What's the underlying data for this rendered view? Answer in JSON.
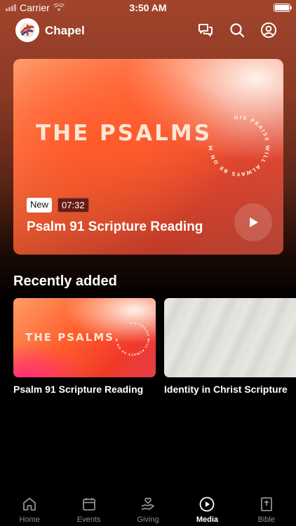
{
  "status_bar": {
    "carrier": "Carrier",
    "time": "3:50 AM"
  },
  "header": {
    "app_title": "Chapel",
    "icons": [
      "chat-icon",
      "search-icon",
      "account-icon"
    ]
  },
  "featured": {
    "artwork_title": "THE PSALMS",
    "artwork_circle_text": "HIS PRAISE WILL ALWAYS BE ON MY LIPS",
    "badge_new": "New",
    "duration": "07:32",
    "title": "Psalm 91 Scripture Reading",
    "icon": "play-icon"
  },
  "recently_added": {
    "heading": "Recently added",
    "items": [
      {
        "title": "Psalm 91 Scripture Reading",
        "artwork_title": "THE PSALMS"
      },
      {
        "title": "Identity in Christ Scripture"
      }
    ]
  },
  "tab_bar": {
    "active": "Media",
    "tabs": [
      {
        "label": "Home",
        "icon": "home-icon"
      },
      {
        "label": "Events",
        "icon": "calendar-icon"
      },
      {
        "label": "Giving",
        "icon": "giving-hand-icon"
      },
      {
        "label": "Media",
        "icon": "play-circle-icon"
      },
      {
        "label": "Bible",
        "icon": "bible-icon"
      }
    ]
  },
  "colors": {
    "header_gradient_top": "#a2442c",
    "featured_accent": "#ff5a2a",
    "tab_inactive": "#8e8e93",
    "tab_active": "#ffffff"
  }
}
